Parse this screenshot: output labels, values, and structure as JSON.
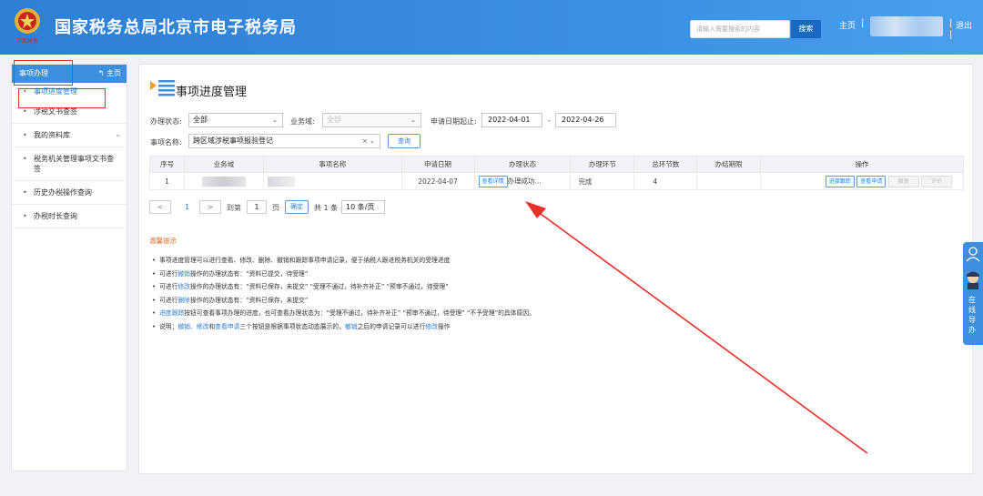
{
  "header": {
    "title": "国家税务总局北京市电子税务局",
    "search_placeholder": "请输入需要搜索的内容",
    "search_button": "搜索",
    "home": "主页",
    "sep": "|",
    "exit": "退出",
    "emblem_caption": "中国税务"
  },
  "sidebar": {
    "title": "事项办理",
    "home": "主页",
    "items": [
      {
        "label": "事项进度管理"
      },
      {
        "label": "涉税文书查签"
      },
      {
        "label": "我的资料库"
      },
      {
        "label": "税务机关管理事项文书查签"
      },
      {
        "label": "历史办税操作查询"
      },
      {
        "label": "办税时长查询"
      }
    ]
  },
  "main": {
    "title": "事项进度管理",
    "filters": {
      "status_label": "办理状态:",
      "status_value": "全部",
      "domain_label": "业务域:",
      "domain_value": "全部",
      "date_label": "申请日期起止:",
      "date_from": "2022-04-01",
      "date_dash": "-",
      "date_to": "2022-04-26",
      "name_label": "事项名称:",
      "name_value": "跨区域涉税事项报验登记",
      "clear": "× ⌄",
      "query_button": "查询"
    },
    "table": {
      "headers": [
        "序号",
        "业务域",
        "事项名称",
        "申请日期",
        "办理状态",
        "办理环节",
        "总环节数",
        "办结期限",
        "操作"
      ],
      "row": {
        "index": "1",
        "date": "2022-04-07",
        "detail_btn": "查看详情",
        "status": "办理成功...",
        "stage": "完成",
        "total": "4",
        "ops": [
          "进度跟踪",
          "查看申请",
          "撤销",
          "评价"
        ]
      }
    },
    "pagination": {
      "prev": "<",
      "page": "1",
      "next": ">",
      "goto": "到第",
      "input": "1",
      "page_unit": "页",
      "confirm": "确定",
      "total": "共 1 条",
      "per_page": "10 条/页"
    },
    "tips": {
      "title": "温馨提示",
      "items": [
        {
          "a": "事项进度管理可以进行查看、修改、删除、撤销和跟踪事项申请记录，便于纳税人跟进税务机关的受理进度"
        },
        {
          "a": "可进行",
          "b": "撤销",
          "c": "操作的办理状态有：“资料已提交，待受理”"
        },
        {
          "a": "可进行",
          "b": "修改",
          "c": "操作的办理状态有：“资料已保存，未提交”  “受理不通过，待补齐补正”  “预审不通过，待受理”"
        },
        {
          "a": "可进行",
          "b": "删除",
          "c": "操作的办理状态有：“资料已保存，未提交”"
        },
        {
          "b": "进度跟踪",
          "c": "按钮可查看事项办理的进度，也可查看办理状态为：“受理不通过，待补齐补正”  “预审不通过，待受理”  “不予受理”的具体原因。"
        },
        {
          "a": "说明：",
          "b": "撤销、修改",
          "c": "和",
          "d": "查看申请",
          "e": "三个按钮是根据事项状态动态展示的，",
          "f": "撤销",
          "g": "之后的申请记录可以进行",
          "h": "修改",
          "i": "操作"
        }
      ]
    }
  },
  "float": {
    "label": "在线导办"
  }
}
